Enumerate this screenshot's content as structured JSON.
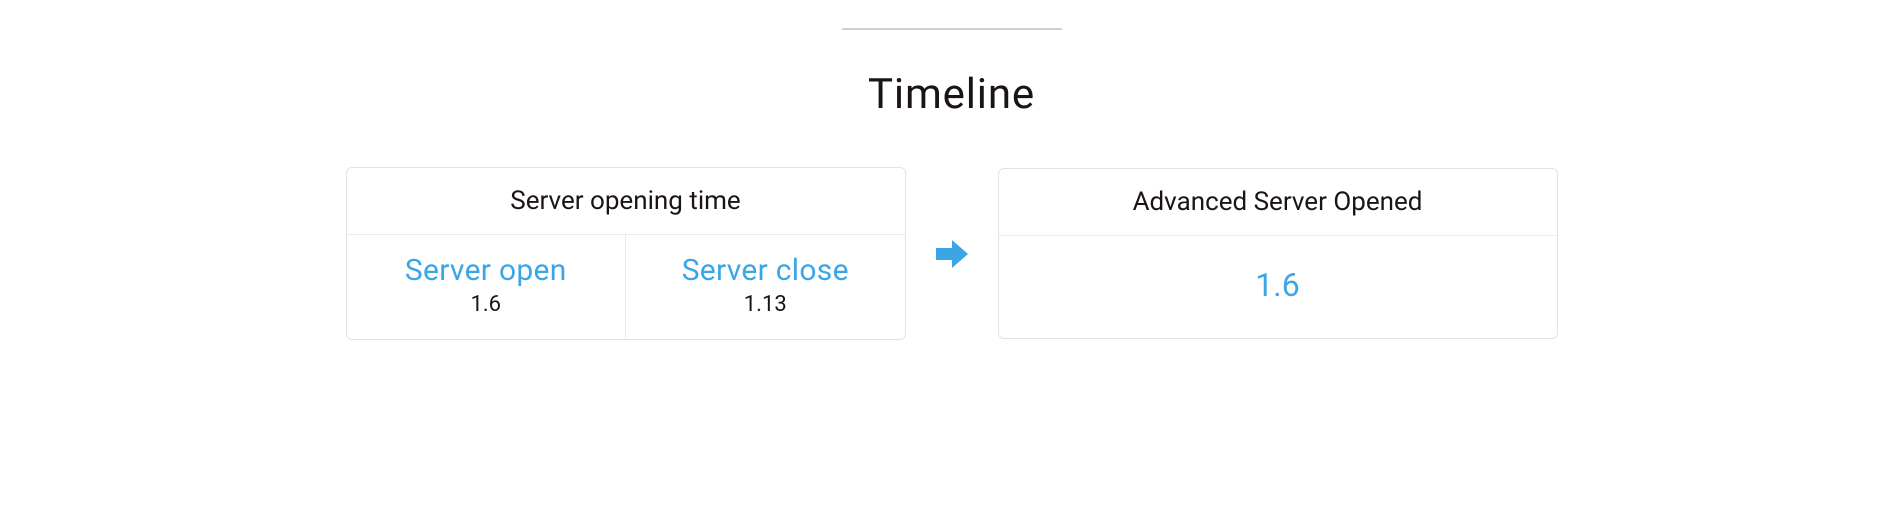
{
  "title": "Timeline",
  "colors": {
    "accent": "#3aa6e6",
    "text": "#1a1512",
    "border": "#e2e2e2"
  },
  "left_card": {
    "header": "Server opening time",
    "cells": [
      {
        "title": "Server open",
        "sub": "1.6"
      },
      {
        "title": "Server close",
        "sub": "1.13"
      }
    ]
  },
  "arrow_icon": "arrow-right",
  "right_card": {
    "header": "Advanced Server Opened",
    "value": "1.6"
  }
}
